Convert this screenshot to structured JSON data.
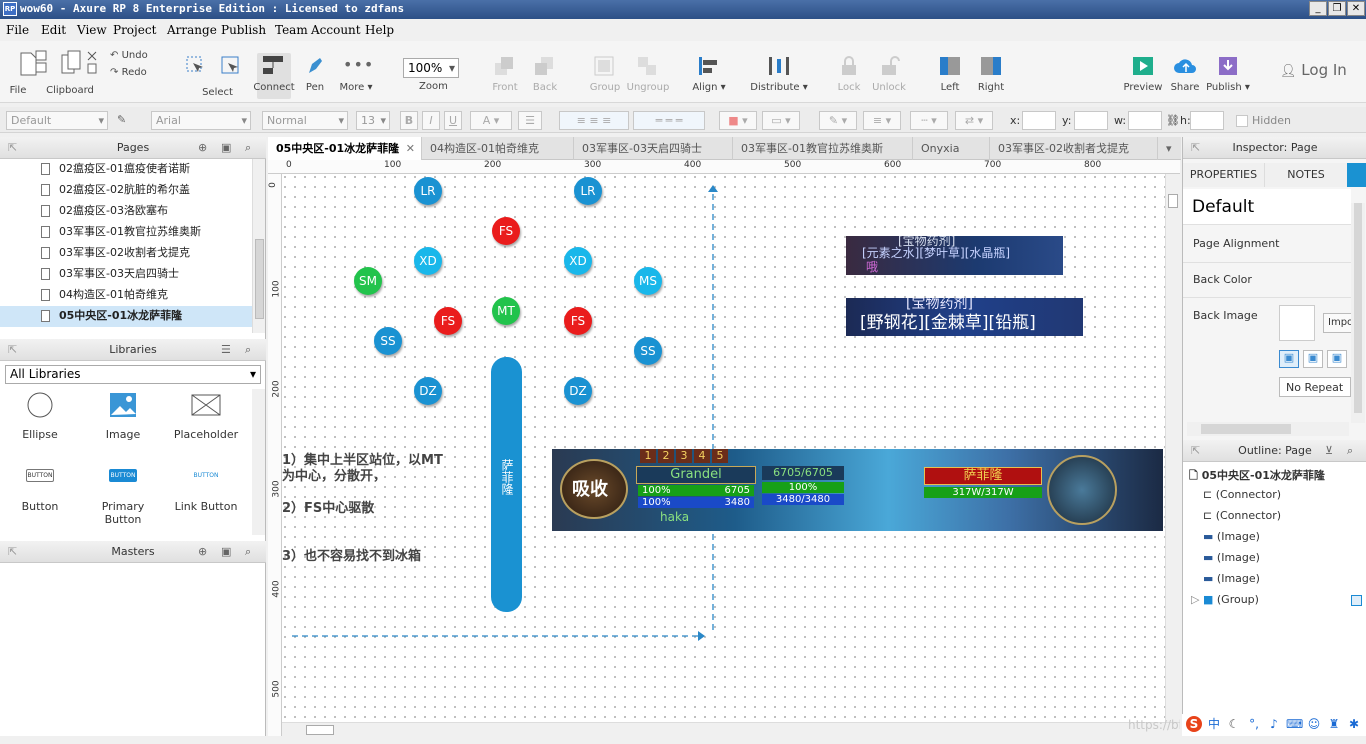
{
  "window": {
    "title": "wow60 - Axure RP 8 Enterprise Edition : Licensed to zdfans",
    "icon_text": "RP"
  },
  "menu": [
    "File",
    "Edit",
    "View",
    "Project",
    "Arrange",
    "Publish",
    "Team",
    "Account",
    "Help"
  ],
  "toolbar": {
    "file": "File",
    "clipboard": "Clipboard",
    "undo": "Undo",
    "redo": "Redo",
    "select": "Select",
    "connect": "Connect",
    "pen": "Pen",
    "more": "More",
    "zoom_value": "100%",
    "zoom": "Zoom",
    "front": "Front",
    "back": "Back",
    "group": "Group",
    "ungroup": "Ungroup",
    "align": "Align",
    "distribute": "Distribute",
    "lock": "Lock",
    "unlock": "Unlock",
    "left": "Left",
    "right": "Right",
    "preview": "Preview",
    "share": "Share",
    "publish": "Publish",
    "login": "Log In"
  },
  "format": {
    "style": "Default",
    "font": "Arial",
    "weight": "Normal",
    "size": "13",
    "x": "x:",
    "y": "y:",
    "w": "w:",
    "h": "h:",
    "hidden": "Hidden"
  },
  "pages": {
    "title": "Pages",
    "items": [
      "02瘟疫区-01瘟疫使者诺斯",
      "02瘟疫区-02肮脏的希尔盖",
      "02瘟疫区-03洛欧塞布",
      "03军事区-01教官拉苏维奥斯",
      "03军事区-02收割者戈提克",
      "03军事区-03天启四骑士",
      "04构造区-01帕奇维克",
      "05中央区-01冰龙萨菲隆"
    ],
    "selected": 7
  },
  "libraries": {
    "title": "Libraries",
    "selector": "All Libraries",
    "items": [
      "Ellipse",
      "Image",
      "Placeholder",
      "Button",
      "Primary Button",
      "Link Button"
    ],
    "button_text": "BUTTON"
  },
  "masters": {
    "title": "Masters"
  },
  "tabs": [
    "05中央区-01冰龙萨菲隆",
    "04构造区-01帕奇维克",
    "03军事区-03天启四骑士",
    "03军事区-01教官拉苏维奥斯",
    "Onyxia",
    "03军事区-02收割者戈提克"
  ],
  "ruler": {
    "h": [
      "0",
      "100",
      "200",
      "300",
      "400",
      "500",
      "600",
      "700",
      "800"
    ],
    "v": [
      "0",
      "100",
      "200",
      "300",
      "400",
      "500"
    ]
  },
  "diagram": {
    "circles": [
      {
        "label": "LR",
        "color": "blue"
      },
      {
        "label": "LR",
        "color": "blue"
      },
      {
        "label": "FS",
        "color": "red"
      },
      {
        "label": "XD",
        "color": "lblue"
      },
      {
        "label": "XD",
        "color": "lblue"
      },
      {
        "label": "SM",
        "color": "green"
      },
      {
        "label": "MS",
        "color": "lblue"
      },
      {
        "label": "FS",
        "color": "red"
      },
      {
        "label": "MT",
        "color": "green"
      },
      {
        "label": "FS",
        "color": "red"
      },
      {
        "label": "SS",
        "color": "blue"
      },
      {
        "label": "SS",
        "color": "blue"
      },
      {
        "label": "DZ",
        "color": "blue"
      },
      {
        "label": "DZ",
        "color": "blue"
      }
    ],
    "boss": "萨菲隆",
    "notes": [
      "1）集中上半区站位，以MT",
      "为中心，分散开，",
      "2）FS中心驱散",
      "3）也不容易找不到冰箱"
    ],
    "img1": {
      "line1": "[元素之水][梦叶草][水晶瓶]",
      "line2": "哦",
      "top": "[宝物药剂]"
    },
    "img2": {
      "line1": "[野钢花][金棘草][铅瓶]",
      "top": "[宝物药剂]"
    },
    "game": {
      "name": "Grandel",
      "hp_pct": "100%",
      "mp_pct": "100%",
      "hp": "6705",
      "mp": "3480",
      "target_hp": "6705/6705",
      "target_pct": "100%",
      "target_mp": "3480/3480",
      "boss": "萨菲隆",
      "boss_hp": "317W/317W",
      "absorb": "吸收",
      "player": "haka",
      "bar_nums": [
        "1",
        "2",
        "3",
        "4",
        "5"
      ]
    }
  },
  "inspector": {
    "title": "Inspector: Page",
    "tab1": "PROPERTIES",
    "tab2": "NOTES",
    "page": "Default",
    "alignment": "Page Alignment",
    "back_color": "Back Color",
    "back_image": "Back Image",
    "import": "Impo",
    "repeat": "No Repeat"
  },
  "outline": {
    "title": "Outline: Page",
    "root": "05中央区-01冰龙萨菲隆",
    "items": [
      "(Connector)",
      "(Connector)",
      "(Image)",
      "(Image)",
      "(Image)",
      "(Group)"
    ]
  },
  "watermark": "https://blog.",
  "tray": {
    "ime": "中"
  },
  "colors": {
    "titlebar": "#2c4f86",
    "accent": "#1a92d2",
    "red": "#ea1c1c",
    "green": "#22c34c",
    "lblue": "#19b7ea"
  }
}
